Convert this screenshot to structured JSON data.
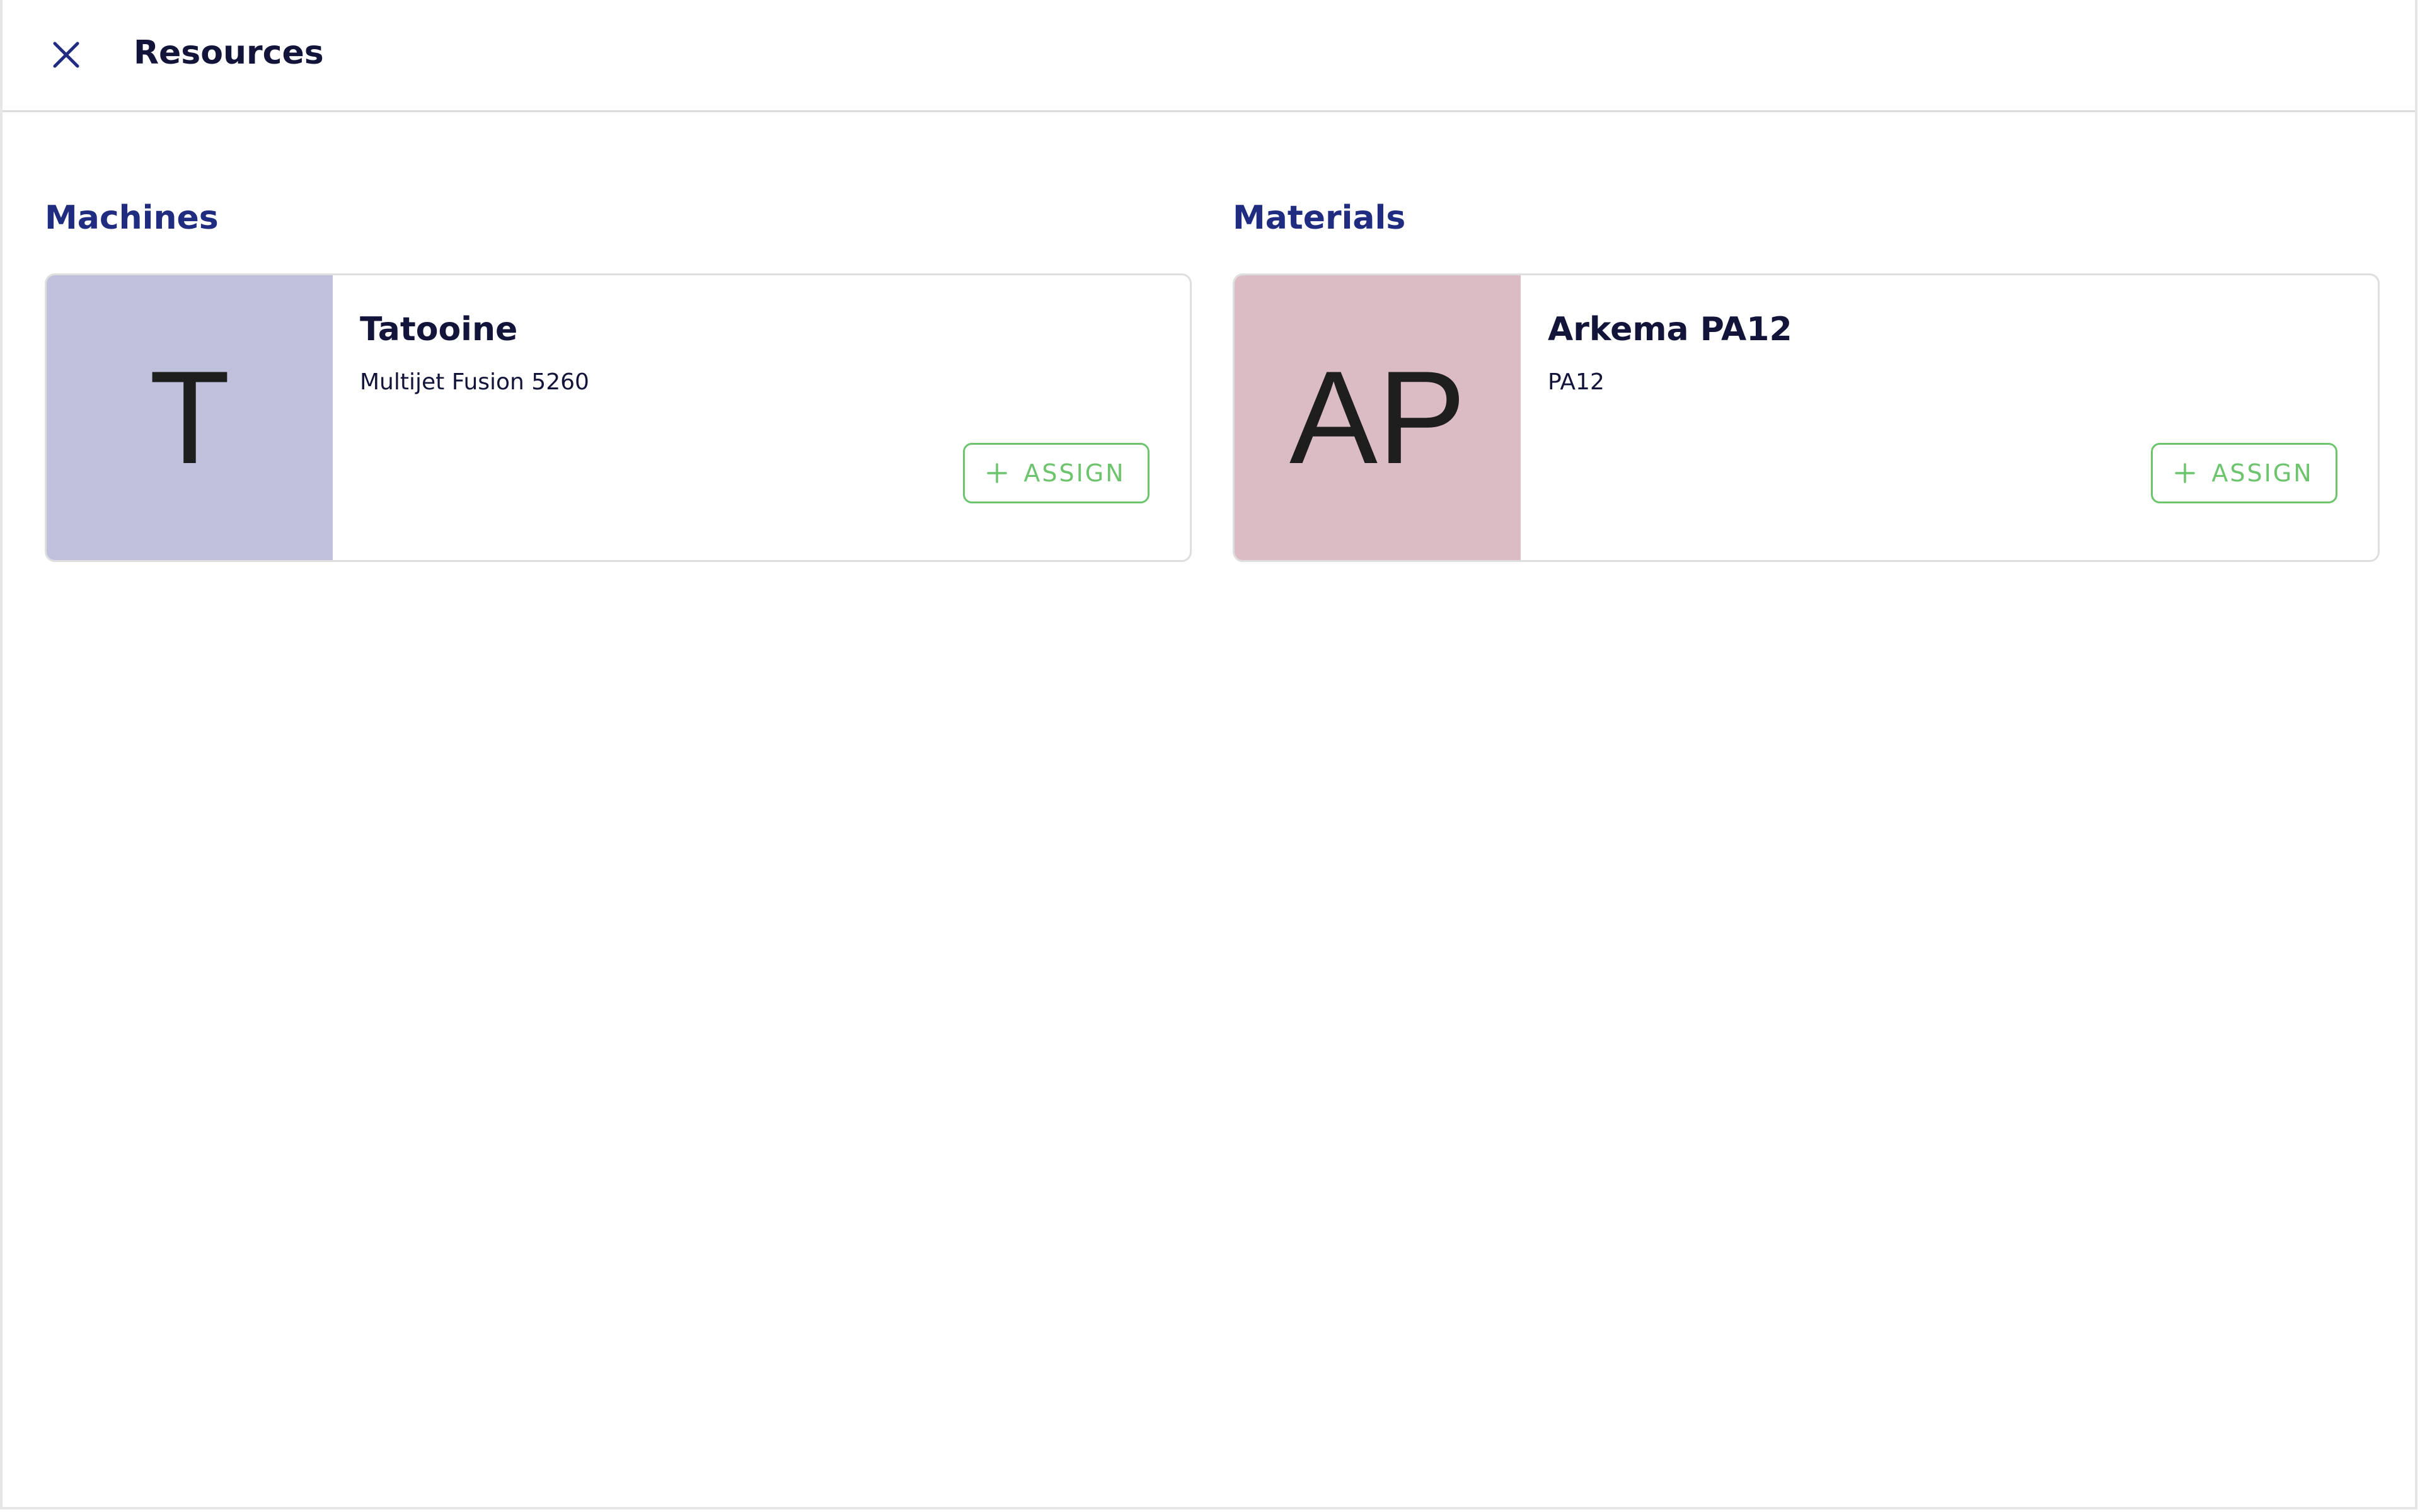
{
  "header": {
    "title": "Resources",
    "close_icon": "close-icon"
  },
  "machines": {
    "title": "Machines",
    "card": {
      "initials": "T",
      "name": "Tatooine",
      "subtitle": "Multijet Fusion 5260",
      "assign_label": "ASSIGN",
      "avatar_color": "#bfc0dc"
    }
  },
  "materials": {
    "title": "Materials",
    "card": {
      "initials": "AP",
      "name": "Arkema PA12",
      "subtitle": "PA12",
      "assign_label": "ASSIGN",
      "avatar_color": "#dbbcc5"
    }
  },
  "colors": {
    "accent_navy": "#1f2c80",
    "text_dark": "#12143a",
    "assign_green": "#6cc46c",
    "border_gray": "#dedede"
  }
}
